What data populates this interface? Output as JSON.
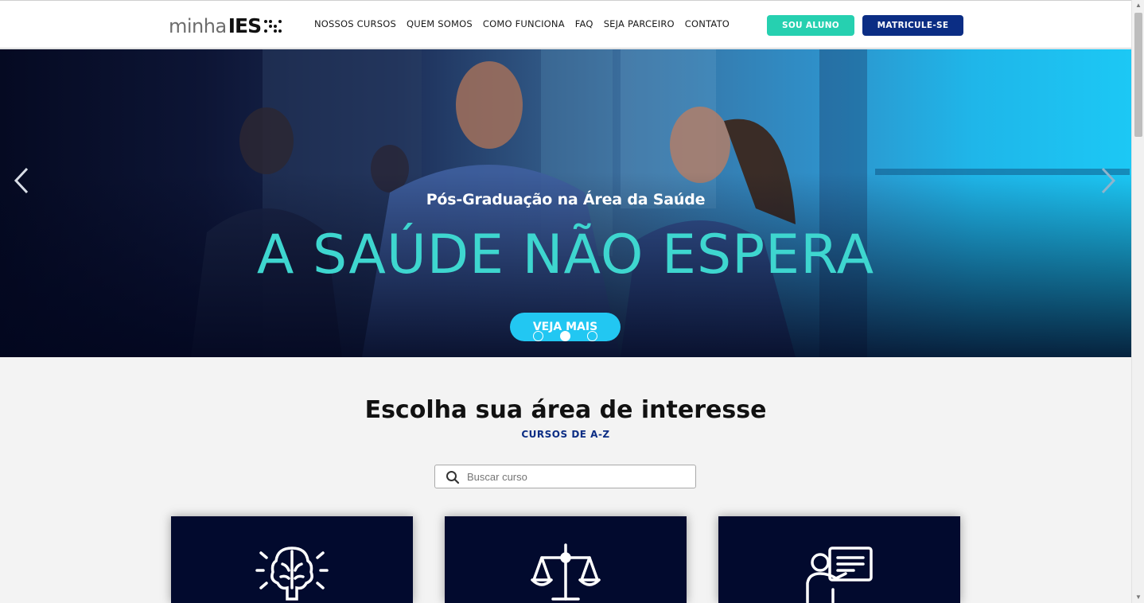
{
  "header": {
    "logo": {
      "text_minha": "minha",
      "text_ies": "IES"
    },
    "nav": [
      "NOSSOS CURSOS",
      "QUEM SOMOS",
      "COMO FUNCIONA",
      "FAQ",
      "SEJA PARCEIRO",
      "CONTATO"
    ],
    "sou_aluno": "SOU ALUNO",
    "matricule": "MATRICULE-SE"
  },
  "hero": {
    "subtitle": "Pós-Graduação na Área da Saúde",
    "title": "A SAÚDE NÃO ESPERA",
    "button": "VEJA MAIS",
    "active_slide": 2,
    "slide_count": 3
  },
  "section": {
    "title": "Escolha sua área de interesse",
    "link": "CURSOS DE A-Z"
  },
  "search": {
    "placeholder": "Buscar curso",
    "value": ""
  },
  "cards": [
    {
      "icon": "brain-lightbulb-icon"
    },
    {
      "icon": "scales-of-justice-icon"
    },
    {
      "icon": "teacher-board-icon"
    }
  ],
  "colors": {
    "accent_teal": "#26d0b0",
    "brand_navy": "#0b2d84",
    "hero_title": "#3ed6cf",
    "hero_button": "#22c7f2",
    "card_bg": "#020a2e"
  }
}
